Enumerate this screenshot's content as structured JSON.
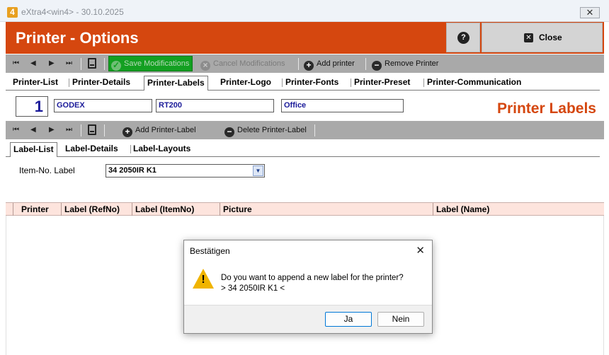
{
  "window": {
    "title": "eXtra4<win4>  -  30.10.2025",
    "logo_letter": "4",
    "close_glyph": "✕"
  },
  "header": {
    "title": "Printer - Options",
    "help_glyph": "?",
    "close_label": "Close",
    "close_glyph": "✕"
  },
  "toolbar": {
    "nav_first": "⏮",
    "nav_prev": "◀",
    "nav_next": "▶",
    "nav_last": "⏭",
    "save_label": "Save Modifications",
    "cancel_label": "Cancel Modifications",
    "add_label": "Add printer",
    "remove_label": "Remove Printer"
  },
  "tabs": [
    {
      "label": "Printer-List"
    },
    {
      "label": "Printer-Details"
    },
    {
      "label": "Printer-Labels",
      "active": true
    },
    {
      "label": "Printer-Logo"
    },
    {
      "label": "Printer-Fonts"
    },
    {
      "label": "Printer-Preset"
    },
    {
      "label": "Printer-Communication"
    }
  ],
  "printer": {
    "number": "1",
    "brand": "GODEX",
    "model": "RT200",
    "location": "Office"
  },
  "page_caption": "Printer Labels",
  "label_toolbar": {
    "add_label": "Add Printer-Label",
    "delete_label": "Delete Printer-Label"
  },
  "subtabs": [
    {
      "label": "Label-List",
      "active": true
    },
    {
      "label": "Label-Details"
    },
    {
      "label": "Label-Layouts"
    }
  ],
  "item_no": {
    "label": "Item-No. Label",
    "value": "34 2050IR K1"
  },
  "grid": {
    "columns": [
      "Printer",
      "Label (RefNo)",
      "Label (ItemNo)",
      "Picture",
      "Label (Name)"
    ]
  },
  "dialog": {
    "title": "Bestätigen",
    "close_glyph": "✕",
    "message_line1": "Do you want to append a new label for the printer?",
    "message_line2": "> 34 2050IR K1 <",
    "yes_label": "Ja",
    "no_label": "Nein"
  },
  "colors": {
    "brand_orange": "#d5470f",
    "save_green": "#13a021",
    "grid_header": "#fde4dd"
  }
}
